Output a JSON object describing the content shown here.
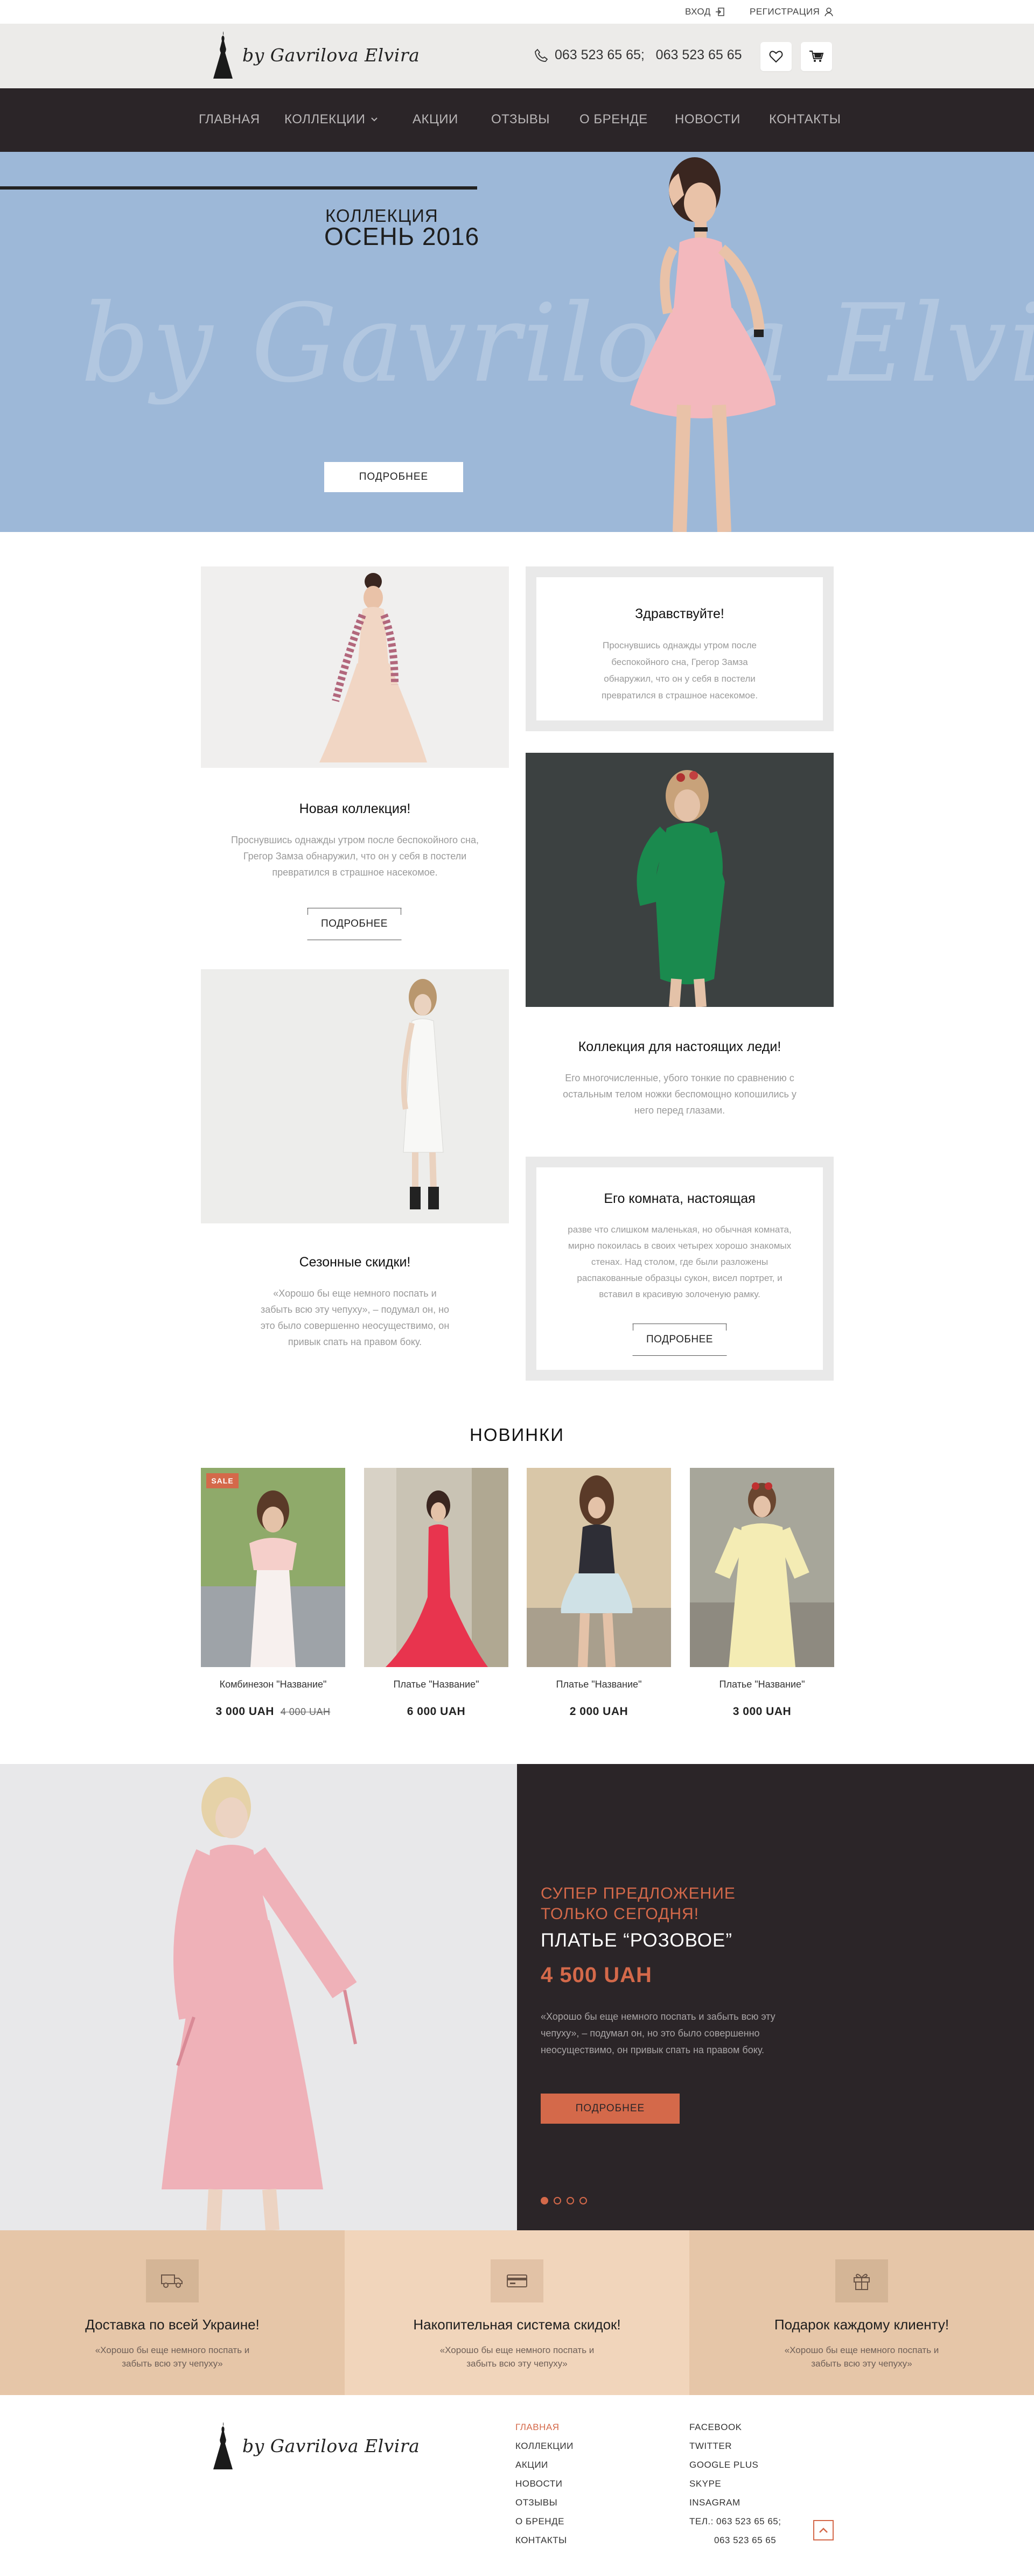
{
  "topbar": {
    "login_label": "ВХОД",
    "register_label": "РЕГИСТРАЦИЯ"
  },
  "header": {
    "logo_text": "by Gavrilova Elvira",
    "phones": "063 523 65 65;   063 523 65 65"
  },
  "nav": {
    "items": [
      {
        "label": "ГЛАВНАЯ"
      },
      {
        "label": "КОЛЛЕКЦИИ"
      },
      {
        "label": "АКЦИИ"
      },
      {
        "label": "ОТЗЫВЫ"
      },
      {
        "label": "О БРЕНДЕ"
      },
      {
        "label": "НОВОСТИ"
      },
      {
        "label": "КОНТАКТЫ"
      }
    ]
  },
  "hero": {
    "watermark": "by Gavrilova Elvira",
    "kicker": "КОЛЛЕКЦИЯ",
    "title": "ОСЕНЬ 2016",
    "button_label": "ПОДРОБНЕЕ"
  },
  "features": {
    "greeting": {
      "title": "Здравствуйте!",
      "text": "Проснувшись однажды утром после беспокойного сна, Грегор Замза обнаружил, что он у себя в постели превратился в страшное насекомое."
    },
    "new_collection": {
      "title": "Новая коллекция!",
      "text": "Проснувшись однажды утром после беспокойного сна, Грегор Замза обнаружил, что он у себя в постели превратился в страшное насекомое.",
      "button_label": "ПОДРОБНЕЕ"
    },
    "ladies": {
      "title": "Коллекция для настоящих леди!",
      "text": "Его многочисленные, убого тонкие по сравнению с остальным телом ножки беспомощно копошились у него перед глазами."
    },
    "seasonal": {
      "title": "Сезонные скидки!",
      "text": "«Хорошо бы еще немного поспать и забыть всю эту чепуху», – подумал он, но это было совершенно неосуществимо, он привык спать на правом боку."
    },
    "room": {
      "title": "Его комната, настоящая",
      "text": "разве что слишком маленькая, но обычная комната, мирно покоилась в своих четырех хорошо знакомых стенах. Над столом, где были разложены распакованные образцы сукон, висел портрет, и вставил в красивую золоченую рамку.",
      "button_label": "ПОДРОБНЕЕ"
    }
  },
  "new_arrivals": {
    "title": "НОВИНКИ",
    "sale_badge": "SALE",
    "products": [
      {
        "name": "Комбинезон \"Название\"",
        "price": "3 000 UAH",
        "old_price": "4 000 UAH"
      },
      {
        "name": "Платье \"Название\"",
        "price": "6 000 UAH"
      },
      {
        "name": "Платье \"Название\"",
        "price": "2 000 UAH"
      },
      {
        "name": "Платье \"Название\"",
        "price": "3 000 UAH"
      }
    ]
  },
  "promo": {
    "kicker_line1": "СУПЕР ПРЕДЛОЖЕНИЕ",
    "kicker_line2": "ТОЛЬКО СЕГОДНЯ!",
    "product": "ПЛАТЬЕ “РОЗОВОЕ”",
    "price": "4 500 UAH",
    "text": "«Хорошо бы еще немного поспать и забыть всю эту чепуху», – подумал он, но это было совершенно неосуществимо, он привык спать на правом боку.",
    "button_label": "ПОДРОБНЕЕ",
    "slides_count": 4,
    "active_slide": 1
  },
  "benefits": [
    {
      "title": "Доставка по всей Украине!",
      "text": "«Хорошо бы еще немного поспать и забыть всю эту чепуху»",
      "icon": "truck-icon",
      "color": "#e6c6a8"
    },
    {
      "title": "Накопительная система скидок!",
      "text": "«Хорошо бы еще немного поспать и забыть всю эту чепуху»",
      "icon": "card-icon",
      "color": "#f1d5bb"
    },
    {
      "title": "Подарок каждому клиенту!",
      "text": "«Хорошо бы еще немного поспать и забыть всю эту чепуху»",
      "icon": "gift-icon",
      "color": "#e6c6a8"
    }
  ],
  "footer": {
    "logo_text": "by Gavrilova Elvira",
    "menu": [
      "ГЛАВНАЯ",
      "КОЛЛЕКЦИИ",
      "АКЦИИ",
      "НОВОСТИ",
      "ОТЗЫВЫ",
      "О БРЕНДЕ",
      "КОНТАКТЫ"
    ],
    "social": [
      "FACEBOOK",
      "TWITTER",
      "GOOGLE PLUS",
      "SKYPE",
      "INSAGRAM"
    ],
    "tel_line1": "ТЕЛ.: 063 523 65 65;",
    "tel_line2": "063 523 65 65"
  },
  "colors": {
    "accent": "#d4694a",
    "nav_bg": "#2b2528",
    "hero_bg": "#9db8d8",
    "header_bg": "#ecebe9"
  }
}
